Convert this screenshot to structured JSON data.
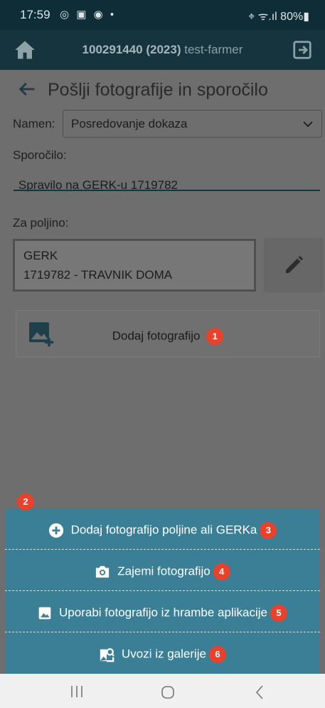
{
  "status_bar": {
    "time": "17:59",
    "left_icons": "◎ ▣ ◉ •",
    "right_text": "⌖ ᯤ.ıl 80%▮"
  },
  "app_bar": {
    "id": "100291440 (2023)",
    "user": "test-farmer"
  },
  "page": {
    "title": "Pošlji fotografije in sporočilo"
  },
  "form": {
    "namen_label": "Namen:",
    "namen_value": "Posredovanje dokaza",
    "message_label": "Sporočilo:",
    "message_value": "Spravilo na GERK-u 1719782",
    "field_label": "Za poljino:",
    "gerk_line1": "GERK",
    "gerk_line2": "1719782 - TRAVNIK DOMA"
  },
  "add_photo": {
    "label": "Dodaj fotografijo",
    "badge": "1"
  },
  "sheet": {
    "badge": "2",
    "items": [
      {
        "label": "Dodaj fotografijo poljine ali GERKa",
        "badge": "3",
        "icon": "plus-circle-icon"
      },
      {
        "label": "Zajemi fotografijo",
        "badge": "4",
        "icon": "camera-icon"
      },
      {
        "label": "Uporabi fotografijo iz hrambe aplikacije",
        "badge": "5",
        "icon": "image-icon"
      },
      {
        "label": "Uvozi iz galerije",
        "badge": "6",
        "icon": "image-search-icon"
      }
    ]
  },
  "colors": {
    "accent": "#3b7f96",
    "badge": "#e8412c",
    "appbar": "#15343d"
  }
}
